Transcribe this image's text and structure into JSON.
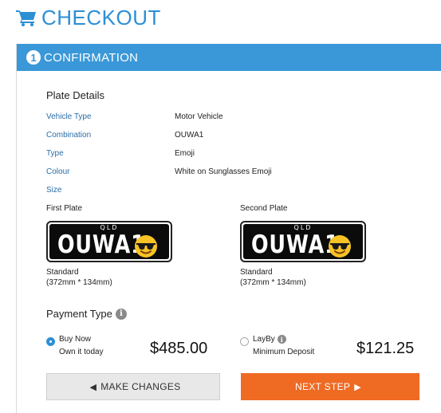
{
  "header": {
    "title": "CHECKOUT",
    "icon": "shopping-cart-icon"
  },
  "step": {
    "number": "1",
    "title": "CONFIRMATION"
  },
  "plate_details": {
    "title": "Plate Details",
    "rows": [
      {
        "label": "Vehicle Type",
        "value": "Motor Vehicle"
      },
      {
        "label": "Combination",
        "value": "OUWA1"
      },
      {
        "label": "Type",
        "value": "Emoji"
      },
      {
        "label": "Colour",
        "value": "White on Sunglasses Emoji"
      },
      {
        "label": "Size",
        "value": ""
      }
    ]
  },
  "plates": [
    {
      "title": "First Plate",
      "region": "QLD",
      "combo": "OUWA1",
      "size_name": "Standard",
      "size_dims": "(372mm * 134mm)"
    },
    {
      "title": "Second Plate",
      "region": "QLD",
      "combo": "OUWA1",
      "size_name": "Standard",
      "size_dims": "(372mm * 134mm)"
    }
  ],
  "payment": {
    "title": "Payment Type",
    "options": [
      {
        "name": "Buy Now",
        "sub": "Own it today",
        "price": "$485.00",
        "selected": true
      },
      {
        "name": "LayBy",
        "sub": "Minimum Deposit",
        "price": "$121.25",
        "selected": false
      }
    ]
  },
  "buttons": {
    "back_label": "MAKE CHANGES",
    "next_label": "NEXT STEP"
  },
  "colors": {
    "primary": "#3a98d8",
    "accent": "#ef6a23",
    "label": "#2a6ea8"
  }
}
